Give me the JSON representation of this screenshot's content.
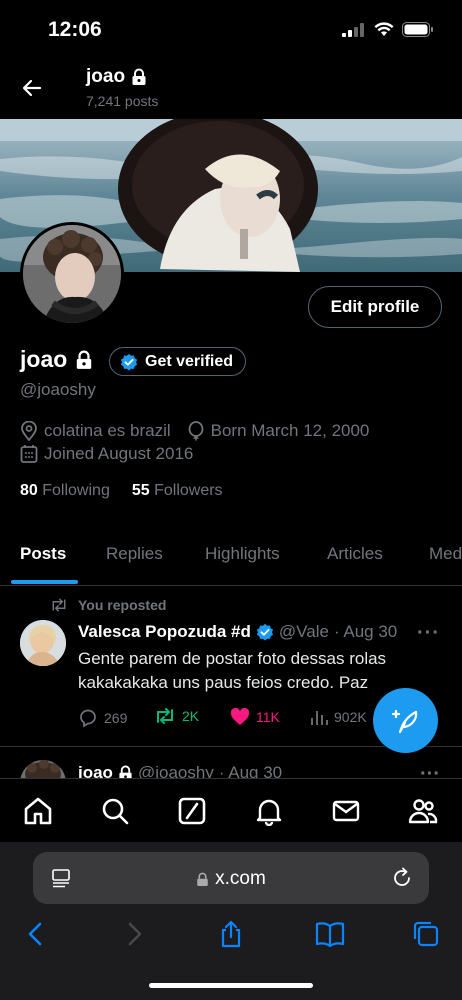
{
  "status": {
    "time": "12:06"
  },
  "header": {
    "name": "joao",
    "posts": "7,241 posts"
  },
  "profile": {
    "edit_label": "Edit profile",
    "name": "joao",
    "verify_label": "Get verified",
    "handle": "@joaoshy",
    "location": "colatina es brazil",
    "birthday": "Born March 12, 2000",
    "joined": "Joined August 2016",
    "following_count": "80",
    "following_label": "Following",
    "followers_count": "55",
    "followers_label": "Followers"
  },
  "tabs": [
    {
      "label": "Posts"
    },
    {
      "label": "Replies"
    },
    {
      "label": "Highlights"
    },
    {
      "label": "Articles"
    },
    {
      "label": "Med"
    }
  ],
  "post1": {
    "repost_label": "You reposted",
    "author": "Valesca Popozuda #d",
    "handle": "@Vale",
    "date": "· Aug 30",
    "text": "Gente parem de postar foto dessas rolas kakakakaka uns paus feios credo. Paz",
    "replies": "269",
    "reposts": "2K",
    "likes": "11K",
    "views": "902K"
  },
  "post2": {
    "author": "joao",
    "handle": "@joaoshy",
    "date": "· Aug 30"
  },
  "browser": {
    "url": "x.com"
  },
  "colors": {
    "accent": "#1d9bf0",
    "repost": "#00ba7c",
    "like": "#f91880"
  }
}
